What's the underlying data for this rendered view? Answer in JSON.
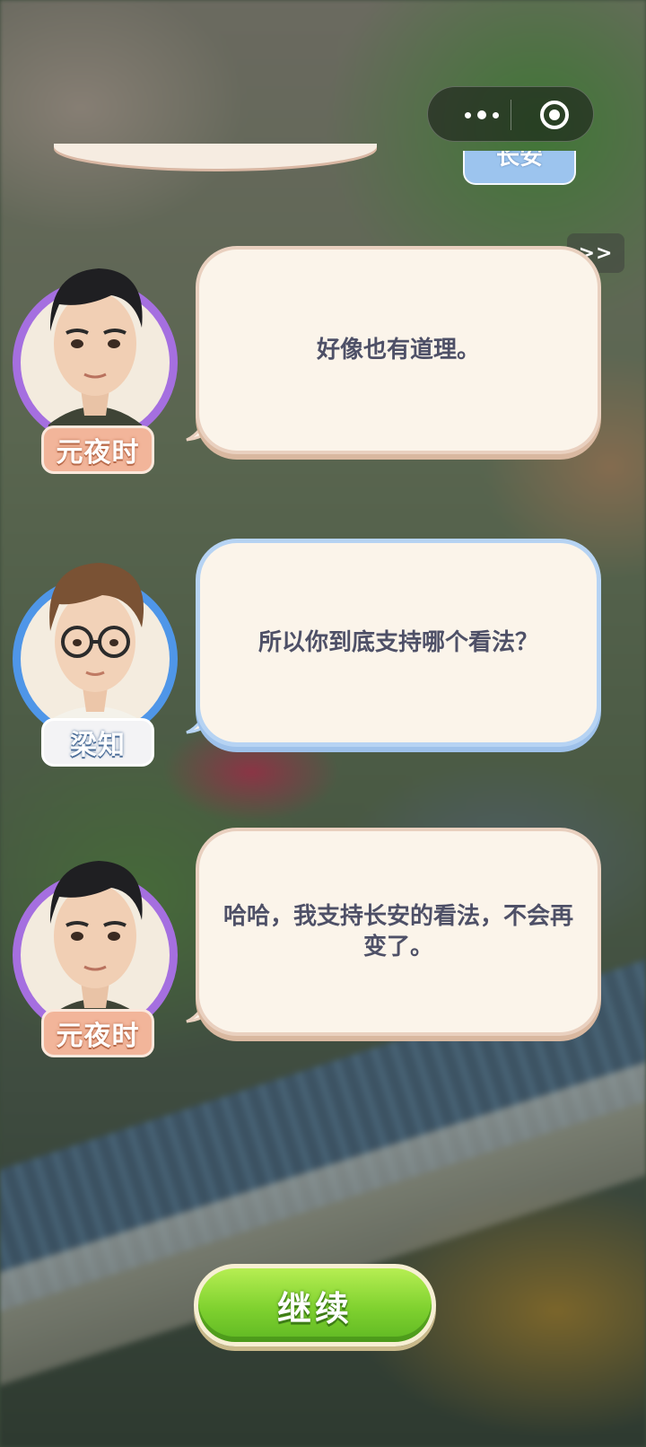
{
  "capsule": {
    "more_icon": "more-dots-icon",
    "close_icon": "target-icon"
  },
  "remnant": {
    "tag_label": "长安"
  },
  "skip_label": ">>",
  "dialogs": [
    {
      "speaker": "元夜时",
      "text": "好像也有道理。",
      "ring_color": "#a56fe0"
    },
    {
      "speaker": "梁知",
      "text": "所以你到底支持哪个看法？",
      "ring_color": "#4f96e8"
    },
    {
      "speaker": "元夜时",
      "text": "哈哈，我支持长安的看法，不会再变了。",
      "ring_color": "#a56fe0"
    }
  ],
  "continue_label": "继续"
}
